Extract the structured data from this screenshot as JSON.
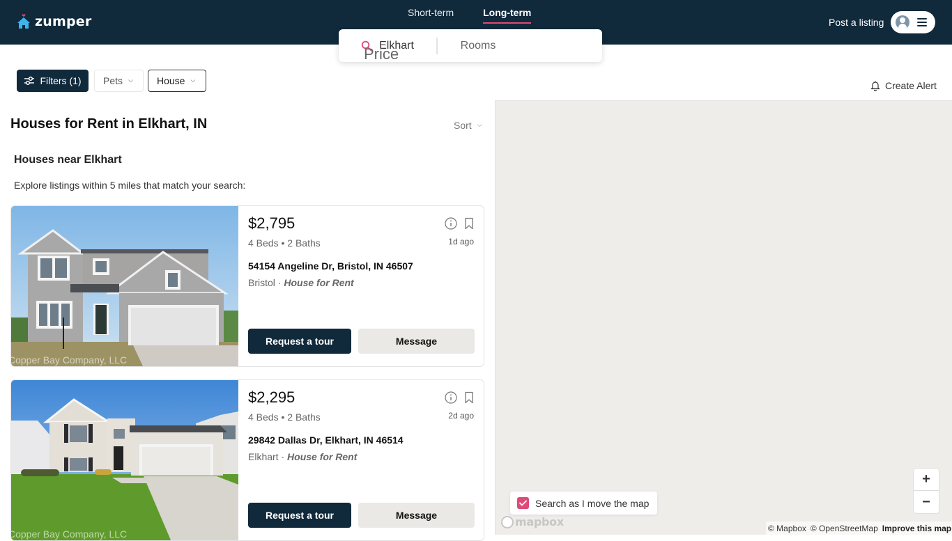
{
  "header": {
    "brand": "zumper",
    "tabs": [
      {
        "label": "Short-term",
        "active": false
      },
      {
        "label": "Long-term",
        "active": true
      }
    ],
    "post_listing": "Post a listing"
  },
  "search": {
    "location": "Elkhart",
    "price": "Price",
    "rooms": "Rooms"
  },
  "filters": {
    "filters_label": "Filters (1)",
    "pets_label": "Pets",
    "house_label": "House",
    "create_alert": "Create Alert"
  },
  "results": {
    "title": "Houses for Rent in Elkhart, IN",
    "sort_label": "Sort",
    "section_title": "Houses near Elkhart",
    "section_sub": "Explore listings within 5 miles that match your search:",
    "listings": [
      {
        "price": "$2,795",
        "beds_baths": "4 Beds • 2 Baths",
        "posted": "1d ago",
        "address": "54154 Angeline Dr, Bristol, IN 46507",
        "city": "Bristol",
        "separator": " · ",
        "type": "House for Rent",
        "photo_credit": "Copper Bay Company, LLC",
        "tour_label": "Request a tour",
        "message_label": "Message"
      },
      {
        "price": "$2,295",
        "beds_baths": "4 Beds • 2 Baths",
        "posted": "2d ago",
        "address": "29842 Dallas Dr, Elkhart, IN 46514",
        "city": "Elkhart",
        "separator": " · ",
        "type": "House for Rent",
        "photo_credit": "Copper Bay Company, LLC",
        "tour_label": "Request a tour",
        "message_label": "Message"
      }
    ]
  },
  "map": {
    "search_as_move": "Search as I move the map",
    "search_as_move_checked": true,
    "mapbox_logo": "mapbox",
    "zoom_in": "+",
    "zoom_out": "−",
    "attribution_mapbox": "© Mapbox",
    "attribution_osm": "© OpenStreetMap",
    "improve": "Improve this map"
  },
  "colors": {
    "navy": "#10293b",
    "accent_pink": "#e0487a",
    "map_bg": "#efedea"
  }
}
